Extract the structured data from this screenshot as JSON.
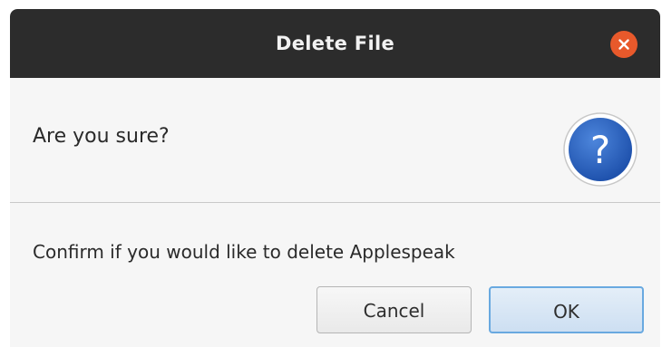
{
  "window": {
    "title": "Delete File",
    "close_icon": "close-icon",
    "close_color": "#e8592b"
  },
  "dialog": {
    "header_text": "Are you sure?",
    "header_icon": "question-icon",
    "question_mark": "?",
    "content_text": "Confirm if you would like to delete Applespeak",
    "buttons": {
      "cancel_label": "Cancel",
      "ok_label": "OK"
    }
  },
  "colors": {
    "titlebar": "#2c2c2c",
    "dialog_bg": "#f6f6f6",
    "icon_blue": "#2f66c4",
    "ok_border": "#69a9e0"
  }
}
